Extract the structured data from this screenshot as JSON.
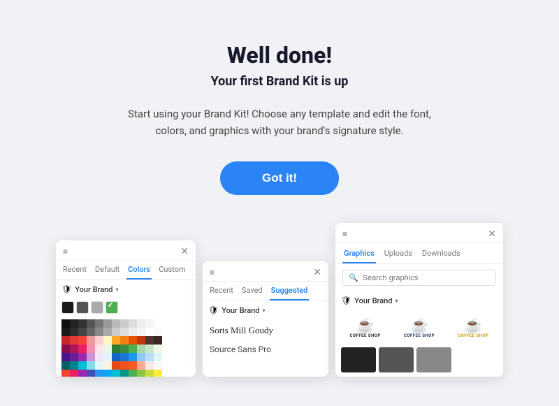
{
  "header": {
    "title": "Well done!",
    "subtitle": "Your first Brand Kit is up",
    "description": "Start using your Brand Kit! Choose any template and edit the font, colors, and graphics with your brand's signature style."
  },
  "cta": {
    "label": "Got it!"
  },
  "left_card": {
    "tabs": [
      "Recent",
      "Default",
      "Colors",
      "Custom"
    ],
    "active_tab": "Colors",
    "brand_label": "Your Brand",
    "swatches": [
      "#000000",
      "#444444",
      "#888888",
      "#bbbbbb",
      "#ffffff"
    ],
    "checked_swatch": "#4caf50"
  },
  "mid_card": {
    "tabs": [
      "Recent",
      "Saved",
      "Suggested"
    ],
    "active_tab": "Suggested",
    "brand_label": "Your Brand",
    "fonts": [
      "Sorts Mill Goudy",
      "Source Sans Pro"
    ]
  },
  "right_card": {
    "tabs": [
      "Graphics",
      "Uploads",
      "Downloads"
    ],
    "active_tab": "Graphics",
    "search_placeholder": "Search graphics",
    "brand_label": "Your Brand",
    "logos": [
      {
        "text": "COFFEE SHOP",
        "color": "black"
      },
      {
        "text": "COFFEE SHOP",
        "color": "navy"
      },
      {
        "text": "COFFEE SHOP",
        "color": "gold"
      }
    ]
  },
  "palette": {
    "rows": [
      [
        "#1a1a1a",
        "#2d2d2d",
        "#444",
        "#666",
        "#888",
        "#aaa",
        "#ccc",
        "#ddd",
        "#eee",
        "#f5f5f5",
        "#fff",
        "#fafafa"
      ],
      [
        "#c62828",
        "#e53935",
        "#f44336",
        "#ef9a9a",
        "#ffcdd2",
        "#fff9c4",
        "#f9a825",
        "#f57f17",
        "#e65100",
        "#bf360c",
        "#4e342e",
        "#3e2723"
      ],
      [
        "#880e4f",
        "#ad1457",
        "#e91e63",
        "#f48fb1",
        "#fce4ec",
        "#e8f5e9",
        "#2e7d32",
        "#388e3c",
        "#4caf50",
        "#a5d6a7",
        "#c8e6c9",
        "#f1f8e9"
      ],
      [
        "#4a148c",
        "#6a1b9a",
        "#9c27b0",
        "#ce93d8",
        "#f3e5f5",
        "#e3f2fd",
        "#1565c0",
        "#1976d2",
        "#2196f3",
        "#90caf9",
        "#bbdefb",
        "#e1f5fe"
      ],
      [
        "#006064",
        "#00838f",
        "#00bcd4",
        "#80deea",
        "#e0f7fa",
        "#fff3e0",
        "#e64a19",
        "#f4511e",
        "#ff5722",
        "#ffab91",
        "#fbe9e7",
        "#fafafa"
      ],
      [
        "#f44336",
        "#e91e63",
        "#9c27b0",
        "#3f51b5",
        "#2196f3",
        "#03a9f4",
        "#00bcd4",
        "#009688",
        "#4caf50",
        "#8bc34a",
        "#cddc39",
        "#ffeb3b"
      ],
      [
        "#ffc107",
        "#ff9800",
        "#ff5722",
        "#795548",
        "#9e9e9e",
        "#607d8b",
        "#d32f2f",
        "#c2185b",
        "#7b1fa2",
        "#512da8",
        "#303f9f",
        "#1976d2"
      ]
    ]
  }
}
